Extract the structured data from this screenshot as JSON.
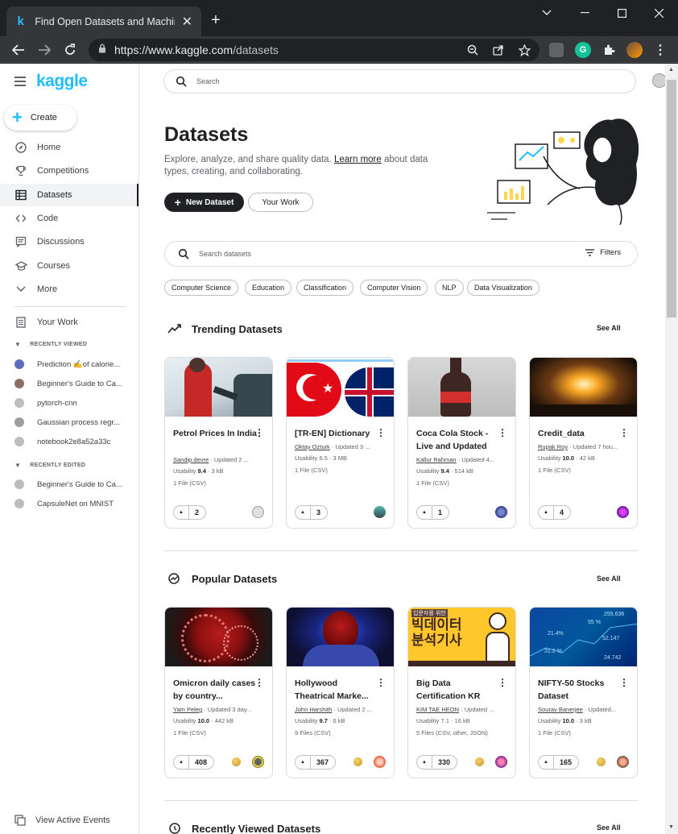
{
  "browser": {
    "tab_title": "Find Open Datasets and Machine",
    "favicon_letter": "k",
    "url_domain": "https://www.kaggle.com",
    "url_path": "/datasets",
    "extension_letter": "G"
  },
  "sidebar": {
    "logo": "kaggle",
    "create_label": "Create",
    "nav": [
      {
        "label": "Home",
        "icon": "compass-icon"
      },
      {
        "label": "Competitions",
        "icon": "trophy-icon"
      },
      {
        "label": "Datasets",
        "icon": "table-icon"
      },
      {
        "label": "Code",
        "icon": "code-icon"
      },
      {
        "label": "Discussions",
        "icon": "comments-icon"
      },
      {
        "label": "Courses",
        "icon": "graduation-cap-icon"
      },
      {
        "label": "More",
        "icon": "chevron-down-icon"
      }
    ],
    "your_work": "Your Work",
    "recently_viewed_label": "RECENTLY VIEWED",
    "recently_viewed": [
      "Prediction ✍️of calorie...",
      "Beginner's Guide to Ca...",
      "pytorch-cnn",
      "Gaussian process regr...",
      "notebook2e8a52a33c"
    ],
    "recently_edited_label": "RECENTLY EDITED",
    "recently_edited": [
      "Beginner's Guide to Ca...",
      "CapsuleNet on MNIST"
    ],
    "view_active_events": "View Active Events"
  },
  "header": {
    "search_placeholder": "Search"
  },
  "hero": {
    "title": "Datasets",
    "description_pre": "Explore, analyze, and share quality data. ",
    "learn_more": "Learn more",
    "description_post": " about data types, creating, and collaborating.",
    "new_dataset": "New Dataset",
    "your_work": "Your Work"
  },
  "dataset_search": {
    "placeholder": "Search datasets",
    "filters": "Filters"
  },
  "chips": [
    "Computer Science",
    "Education",
    "Classification",
    "Computer Vision",
    "NLP",
    "Data Visualization"
  ],
  "trending": {
    "title": "Trending Datasets",
    "see_all": "See All",
    "cards": [
      {
        "title": "Petrol Prices In India",
        "author": "Sandip devre",
        "updated": " · Updated 2 ...",
        "usability": "9.4",
        "size": " · 3 kB",
        "files": "1 File (CSV)",
        "votes": "2"
      },
      {
        "title": "[TR-EN] Dictionary",
        "author": "Oktay Ozturk",
        "updated": " · Updated 3 ...",
        "usability": "6.5",
        "size": " · 3 MB",
        "files": "1 File (CSV)",
        "votes": "3"
      },
      {
        "title": "Coca Cola Stock - Live and Updated",
        "author": "Kallur Rahman",
        "updated": " · Updated 4...",
        "usability": "9.4",
        "size": " · 514 kB",
        "files": "1 File (CSV)",
        "votes": "1"
      },
      {
        "title": "Credit_data",
        "author": "Rupak Roy",
        "updated": " · Updated 7 hou...",
        "usability": "10.0",
        "size": " · 42 kB",
        "files": "1 File (CSV)",
        "votes": "4"
      }
    ]
  },
  "popular": {
    "title": "Popular Datasets",
    "see_all": "See All",
    "cards": [
      {
        "title": "Omicron daily cases by country...",
        "author": "Yam Peleg",
        "updated": " · Updated 3 day...",
        "usability": "10.0",
        "size": " · 442 kB",
        "files": "1 File (CSV)",
        "votes": "408"
      },
      {
        "title": "Hollywood Theatrical Marke...",
        "author": "John Harshith",
        "updated": " · Updated 2 ...",
        "usability": "9.7",
        "size": " · 6 kB",
        "files": "9 Files (CSV)",
        "votes": "367"
      },
      {
        "title": "Big Data Certification KR",
        "author": "KIM TAE HEON",
        "updated": " · Updated ...",
        "usability": "7.1",
        "size": " · 16 kB",
        "files": "5 Files (CSV, other, JSON)",
        "votes": "330"
      },
      {
        "title": "NIFTY-50 Stocks Dataset",
        "author": "Sourav Banerjee",
        "updated": " · Updated...",
        "usability": "10.0",
        "size": " · 3 kB",
        "files": "1 File (CSV)",
        "votes": "165"
      }
    ]
  },
  "image_text": {
    "korean_banner": "빅데이터\n분석기사",
    "korean_small": "입문자를 위한",
    "stock_numbers": [
      "255.636",
      "55 %",
      "52.147",
      "21.4%",
      "31.2 %",
      "24.742"
    ]
  },
  "recently_viewed_section": {
    "title": "Recently Viewed Datasets",
    "see_all": "See All"
  },
  "usability_label": "Usability ",
  "colors": {
    "brand": "#20beff",
    "dark_button": "#202124",
    "chrome_bg": "#202124"
  }
}
